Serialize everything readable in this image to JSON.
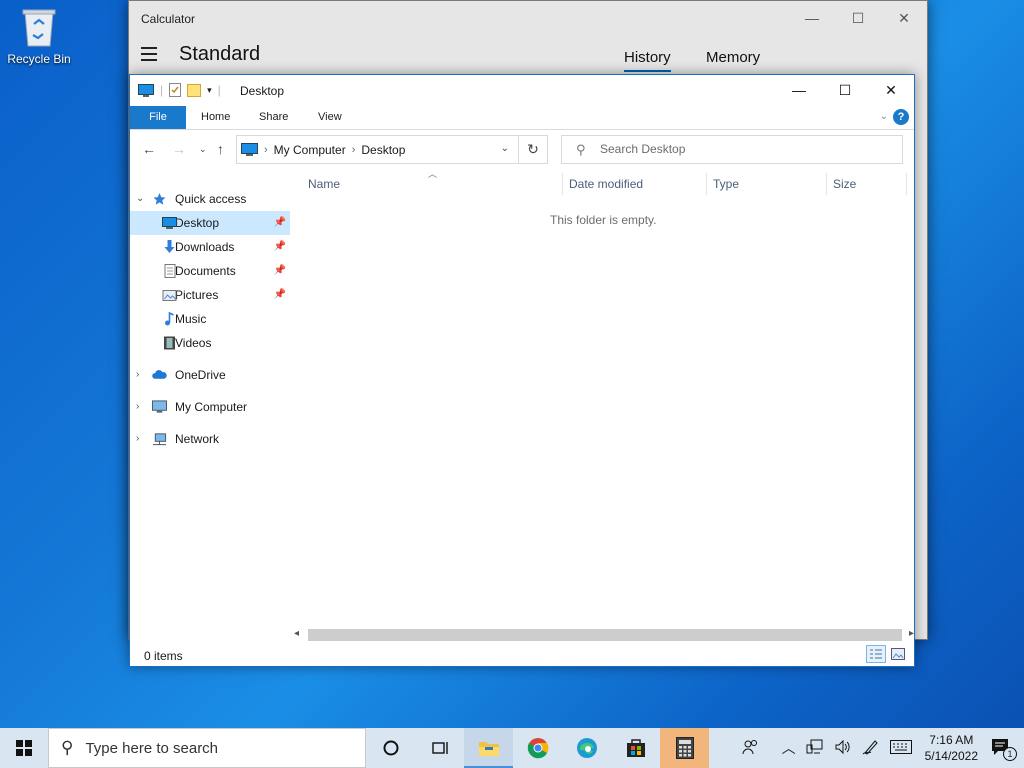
{
  "desktop": {
    "recycle_bin_label": "Recycle Bin"
  },
  "calculator": {
    "title": "Calculator",
    "mode": "Standard",
    "tabs": [
      "History",
      "Memory"
    ],
    "active_tab": "History"
  },
  "explorer": {
    "title": "Desktop",
    "ribbon_tabs": {
      "file": "File",
      "home": "Home",
      "share": "Share",
      "view": "View"
    },
    "help_label": "?",
    "breadcrumb": [
      "My Computer",
      "Desktop"
    ],
    "search_placeholder": "Search Desktop",
    "columns": [
      "Name",
      "Date modified",
      "Type",
      "Size"
    ],
    "empty_message": "This folder is empty.",
    "nav": {
      "quick_access": "Quick access",
      "quick_items": [
        "Desktop",
        "Downloads",
        "Documents",
        "Pictures",
        "Music",
        "Videos"
      ],
      "onedrive": "OneDrive",
      "my_computer": "My Computer",
      "network": "Network"
    },
    "status": "0 items"
  },
  "taskbar": {
    "search_placeholder": "Type here to search",
    "time": "7:16 AM",
    "date": "5/14/2022",
    "notification_count": "1"
  },
  "colors": {
    "accent": "#1979ca",
    "selection": "#cce8ff",
    "taskbar": "#d9e6f2"
  }
}
